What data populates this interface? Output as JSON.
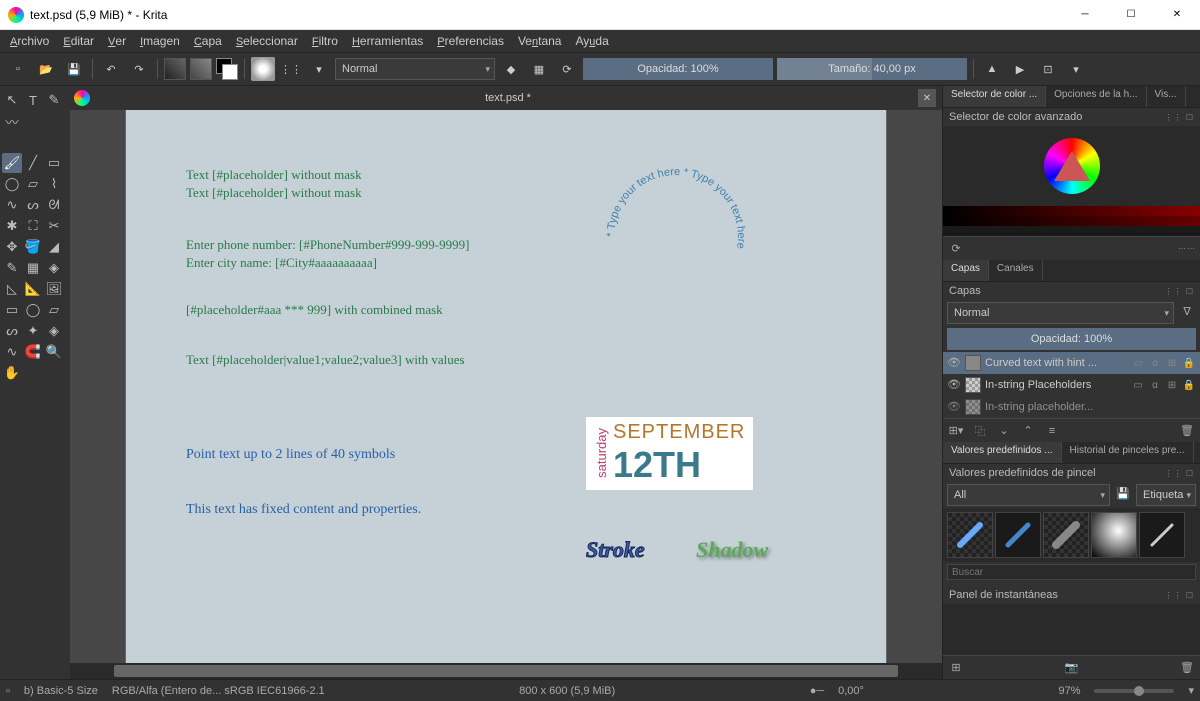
{
  "window": {
    "title": "text.psd (5,9 MiB)  * - Krita"
  },
  "menu": [
    "Archivo",
    "Editar",
    "Ver",
    "Imagen",
    "Capa",
    "Seleccionar",
    "Filtro",
    "Herramientas",
    "Preferencias",
    "Ventana",
    "Ayuda"
  ],
  "toolbar": {
    "blend_mode": "Normal",
    "opacity_label": "Opacidad: 100%",
    "size_label": "Tamaño: 40,00 px"
  },
  "tab": {
    "title": "text.psd *"
  },
  "canvas": {
    "line1": "Text [#placeholder] without mask",
    "line2": "Text [#placeholder] without mask",
    "phone": "Enter phone number: [#PhoneNumber#999-999-9999]",
    "city": "Enter city name: [#City#aaaaaaaaaa]",
    "combined": "[#placeholder#aaa *** 999] with combined mask",
    "values": "Text [#placeholder|value1;value2;value3] with values",
    "point": "Point text up to 2 lines of 40 symbols",
    "fixed": "This text has fixed content and properties.",
    "circular": "* Type your text here * Type your text here ",
    "saturday": "saturday",
    "september": "SEPTEMBER",
    "d12th": "12TH",
    "stroke": "Stroke",
    "shadow": "Shadow"
  },
  "right": {
    "tabs_top": [
      "Selector de color ...",
      "Opciones de la h...",
      "Vis..."
    ],
    "color_title": "Selector de color avanzado",
    "layer_tabs": [
      "Capas",
      "Canales"
    ],
    "layers_title": "Capas",
    "layer_blend": "Normal",
    "layer_opacity": "Opacidad:  100%",
    "layers": [
      "Curved text with hint ...",
      "In-string Placeholders",
      "In-string placeholder..."
    ],
    "preset_tabs": [
      "Valores predefinidos ...",
      "Historial de pinceles pre..."
    ],
    "presets_title": "Valores predefinidos de pincel",
    "preset_filter": "All",
    "preset_tag": "Etiqueta",
    "search_placeholder": "Buscar",
    "snapshot_title": "Panel de instantáneas"
  },
  "status": {
    "brush": "b) Basic-5 Size",
    "colorspace": "RGB/Alfa (Entero de...  sRGB IEC61966-2.1",
    "dims": "800 x 600 (5,9 MiB)",
    "angle": "0,00°",
    "zoom": "97%"
  }
}
